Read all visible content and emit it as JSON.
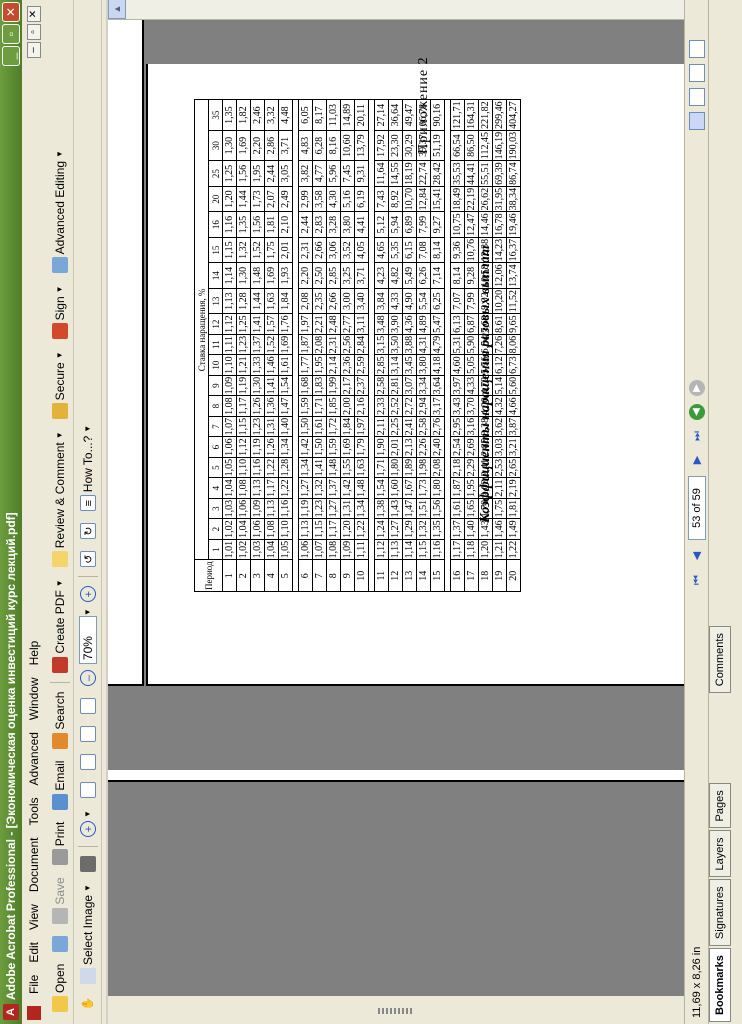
{
  "window": {
    "title": "Adobe Acrobat Professional - [Экономическая оценка инвестиций курс лекций.pdf]"
  },
  "menu": [
    "File",
    "Edit",
    "View",
    "Document",
    "Tools",
    "Advanced",
    "Window",
    "Help"
  ],
  "toolbar1": {
    "open": "Open",
    "save": "Save",
    "print": "Print",
    "email": "Email",
    "search": "Search",
    "create_pdf": "Create PDF",
    "review_comment": "Review & Comment",
    "secure": "Secure",
    "sign": "Sign",
    "advanced_editing": "Advanced Editing"
  },
  "toolbar2": {
    "select_image": "Select Image",
    "zoom": "70%",
    "how_to": "How To...?"
  },
  "panels": {
    "tabs": [
      "Bookmarks",
      "Signatures",
      "Layers",
      "Pages"
    ],
    "comments": "Comments"
  },
  "status": {
    "page_size": "11,69 x 8,26 in",
    "page_indicator": "53 of 59"
  },
  "document": {
    "appendix": "Приложение 2",
    "table_title": "Коэффициенты наращения разовых выплат",
    "col_period": "Период",
    "col_rate": "Ставка наращения, %",
    "rates": [
      "1",
      "2",
      "3",
      "4",
      "5",
      "6",
      "7",
      "8",
      "9",
      "10",
      "11",
      "12",
      "13",
      "14",
      "15",
      "16",
      "20",
      "25",
      "30",
      "35"
    ],
    "rows": [
      [
        "1",
        "1,01",
        "1,02",
        "1,03",
        "1,04",
        "1,05",
        "1,06",
        "1,07",
        "1,08",
        "1,09",
        "1,10",
        "1,11",
        "1,12",
        "1,13",
        "1,14",
        "1,15",
        "1,16",
        "1,20",
        "1,25",
        "1,30",
        "1,35"
      ],
      [
        "2",
        "1,02",
        "1,04",
        "1,06",
        "1,08",
        "1,10",
        "1,12",
        "1,15",
        "1,17",
        "1,19",
        "1,21",
        "1,23",
        "1,25",
        "1,28",
        "1,30",
        "1,32",
        "1,35",
        "1,44",
        "1,56",
        "1,69",
        "1,82"
      ],
      [
        "3",
        "1,03",
        "1,06",
        "1,09",
        "1,13",
        "1,16",
        "1,19",
        "1,23",
        "1,26",
        "1,30",
        "1,33",
        "1,37",
        "1,41",
        "1,44",
        "1,48",
        "1,52",
        "1,56",
        "1,73",
        "1,95",
        "2,20",
        "2,46"
      ],
      [
        "4",
        "1,04",
        "1,08",
        "1,13",
        "1,17",
        "1,22",
        "1,26",
        "1,31",
        "1,36",
        "1,41",
        "1,46",
        "1,52",
        "1,57",
        "1,63",
        "1,69",
        "1,75",
        "1,81",
        "2,07",
        "2,44",
        "2,86",
        "3,32"
      ],
      [
        "5",
        "1,05",
        "1,10",
        "1,16",
        "1,22",
        "1,28",
        "1,34",
        "1,40",
        "1,47",
        "1,54",
        "1,61",
        "1,69",
        "1,76",
        "1,84",
        "1,93",
        "2,01",
        "2,10",
        "2,49",
        "3,05",
        "3,71",
        "4,48"
      ],
      [
        "6",
        "1,06",
        "1,13",
        "1,19",
        "1,27",
        "1,34",
        "1,42",
        "1,50",
        "1,59",
        "1,68",
        "1,77",
        "1,87",
        "1,97",
        "2,08",
        "2,20",
        "2,31",
        "2,44",
        "2,99",
        "3,82",
        "4,83",
        "6,05"
      ],
      [
        "7",
        "1,07",
        "1,15",
        "1,23",
        "1,32",
        "1,41",
        "1,50",
        "1,61",
        "1,71",
        "1,83",
        "1,95",
        "2,08",
        "2,21",
        "2,35",
        "2,50",
        "2,66",
        "2,83",
        "3,58",
        "4,77",
        "6,28",
        "8,17"
      ],
      [
        "8",
        "1,08",
        "1,17",
        "1,27",
        "1,37",
        "1,48",
        "1,59",
        "1,72",
        "1,85",
        "1,99",
        "2,14",
        "2,31",
        "2,48",
        "2,66",
        "2,85",
        "3,06",
        "3,28",
        "4,30",
        "5,96",
        "8,16",
        "11,03"
      ],
      [
        "9",
        "1,09",
        "1,20",
        "1,31",
        "1,42",
        "1,55",
        "1,69",
        "1,84",
        "2,00",
        "2,17",
        "2,36",
        "2,56",
        "2,77",
        "3,00",
        "3,25",
        "3,52",
        "3,80",
        "5,16",
        "7,45",
        "10,60",
        "14,89"
      ],
      [
        "10",
        "1,11",
        "1,22",
        "1,34",
        "1,48",
        "1,63",
        "1,79",
        "1,97",
        "2,16",
        "2,37",
        "2,59",
        "2,84",
        "3,11",
        "3,40",
        "3,71",
        "4,05",
        "4,41",
        "6,19",
        "9,31",
        "13,79",
        "20,11"
      ],
      [
        "11",
        "1,12",
        "1,24",
        "1,38",
        "1,54",
        "1,71",
        "1,90",
        "2,11",
        "2,33",
        "2,58",
        "2,85",
        "3,15",
        "3,48",
        "3,84",
        "4,23",
        "4,65",
        "5,12",
        "7,43",
        "11,64",
        "17,92",
        "27,14"
      ],
      [
        "12",
        "1,13",
        "1,27",
        "1,43",
        "1,60",
        "1,80",
        "2,01",
        "2,25",
        "2,52",
        "2,81",
        "3,14",
        "3,50",
        "3,90",
        "4,33",
        "4,82",
        "5,35",
        "5,94",
        "8,92",
        "14,55",
        "23,30",
        "36,64"
      ],
      [
        "13",
        "1,14",
        "1,29",
        "1,47",
        "1,67",
        "1,89",
        "2,13",
        "2,41",
        "2,72",
        "3,07",
        "3,45",
        "3,88",
        "4,36",
        "4,90",
        "5,49",
        "6,15",
        "6,89",
        "10,70",
        "18,19",
        "30,29",
        "49,47"
      ],
      [
        "14",
        "1,15",
        "1,32",
        "1,51",
        "1,73",
        "1,98",
        "2,26",
        "2,58",
        "2,94",
        "3,34",
        "3,80",
        "4,31",
        "4,89",
        "5,54",
        "6,26",
        "7,08",
        "7,99",
        "12,84",
        "22,74",
        "39,37",
        "66,78"
      ],
      [
        "15",
        "1,16",
        "1,35",
        "1,56",
        "1,80",
        "2,08",
        "2,40",
        "2,76",
        "3,17",
        "3,64",
        "4,18",
        "4,79",
        "5,47",
        "6,25",
        "7,14",
        "8,14",
        "9,27",
        "15,41",
        "28,42",
        "51,19",
        "90,16"
      ],
      [
        "16",
        "1,17",
        "1,37",
        "1,61",
        "1,87",
        "2,18",
        "2,54",
        "2,95",
        "3,43",
        "3,97",
        "4,60",
        "5,31",
        "6,13",
        "7,07",
        "8,14",
        "9,36",
        "10,75",
        "18,49",
        "35,53",
        "66,54",
        "121,71"
      ],
      [
        "17",
        "1,18",
        "1,40",
        "1,65",
        "1,95",
        "2,29",
        "2,69",
        "3,16",
        "3,70",
        "4,33",
        "5,05",
        "5,90",
        "6,87",
        "7,99",
        "9,28",
        "10,76",
        "12,47",
        "22,19",
        "44,41",
        "86,50",
        "164,31"
      ],
      [
        "18",
        "1,20",
        "1,43",
        "1,70",
        "2,03",
        "2,41",
        "2,85",
        "3,38",
        "4,00",
        "4,72",
        "5,56",
        "6,54",
        "7,69",
        "9,02",
        "10,58",
        "12,38",
        "14,46",
        "26,62",
        "55,51",
        "112,45",
        "221,82"
      ],
      [
        "19",
        "1,21",
        "1,46",
        "1,75",
        "2,11",
        "2,53",
        "3,03",
        "3,62",
        "4,32",
        "5,14",
        "6,12",
        "7,26",
        "8,61",
        "10,20",
        "12,06",
        "14,23",
        "16,78",
        "31,95",
        "69,39",
        "146,19",
        "299,46"
      ],
      [
        "20",
        "1,22",
        "1,49",
        "1,81",
        "2,19",
        "2,65",
        "3,21",
        "3,87",
        "4,66",
        "5,60",
        "6,73",
        "8,06",
        "9,65",
        "11,52",
        "13,74",
        "16,37",
        "19,46",
        "38,34",
        "86,74",
        "190,03",
        "404,27"
      ]
    ]
  }
}
